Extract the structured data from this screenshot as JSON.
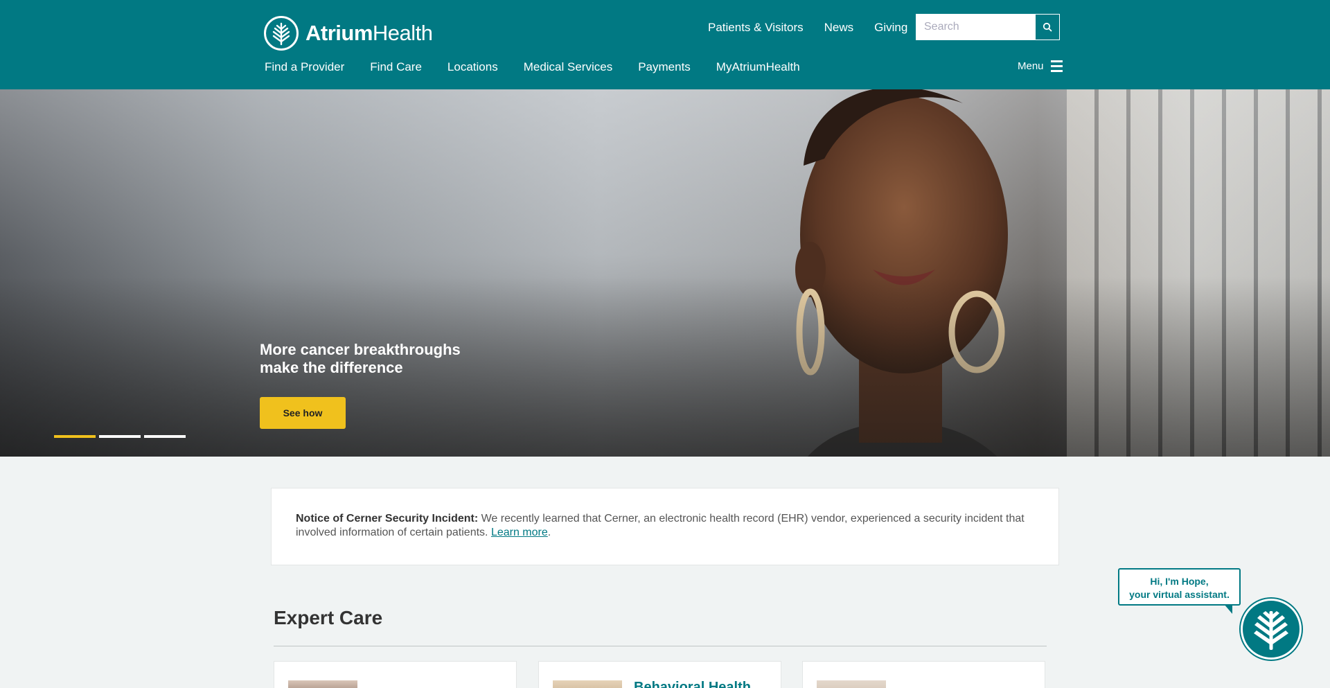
{
  "brand": {
    "name_bold": "Atrium",
    "name_light": "Health"
  },
  "utility_nav": [
    "Patients & Visitors",
    "News",
    "Giving"
  ],
  "search": {
    "placeholder": "Search"
  },
  "main_nav": [
    "Find a Provider",
    "Find Care",
    "Locations",
    "Medical Services",
    "Payments",
    "MyAtriumHealth"
  ],
  "menu": {
    "label": "Menu"
  },
  "hero": {
    "title_line1": "More cancer breakthroughs",
    "title_line2": "make the difference",
    "cta": "See how",
    "slides": 3,
    "active_slide": 1
  },
  "notice": {
    "label": "Notice of Cerner Security Incident:",
    "text": " We recently learned that Cerner, an electronic health record (EHR) vendor, experienced a security incident that involved information of certain patients. ",
    "link": "Learn more",
    "trail": "."
  },
  "expert_care": {
    "title": "Expert Care",
    "cards": [
      {
        "title": ""
      },
      {
        "title": "Behavioral Health"
      },
      {
        "title": ""
      }
    ]
  },
  "assistant": {
    "line1": "Hi, I'm Hope,",
    "line2": "your virtual assistant."
  },
  "colors": {
    "brand": "#017983",
    "accent": "#f0c11d",
    "background": "#f0f3f3"
  }
}
